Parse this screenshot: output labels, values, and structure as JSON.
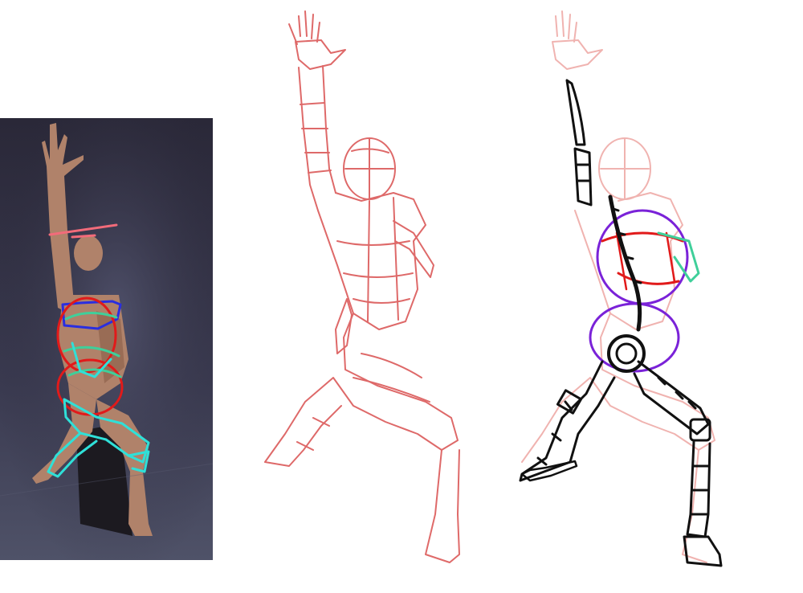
{
  "panels": [
    {
      "id": "photo",
      "subject": "photo-reference-with-construction-overlay"
    },
    {
      "id": "sketch",
      "subject": "red-mannequin-construction-sketch"
    },
    {
      "id": "robot",
      "subject": "mechanical-figure-line-overlay"
    }
  ],
  "colors": {
    "background": "#ffffff",
    "photo_bg_top": "#2c2a3b",
    "photo_bg_bottom": "#4a4c62",
    "skin": "#b98a70",
    "sketch_red": "#d9504f",
    "sketch_pink": "#f0b3b0",
    "overlay_blue": "#2a2ee0",
    "overlay_red": "#e11a1a",
    "overlay_cyan": "#2fe0d8",
    "overlay_green": "#3fcf9a",
    "overlay_purple": "#7a22d8",
    "ink_black": "#111111"
  }
}
